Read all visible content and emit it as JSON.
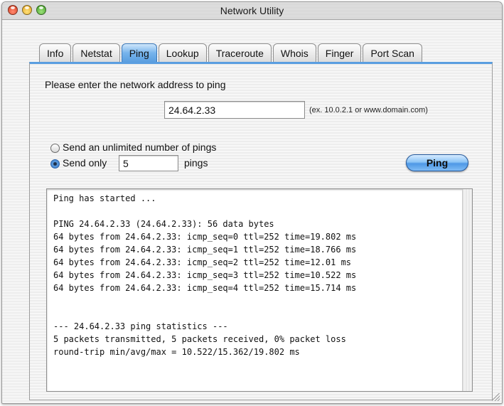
{
  "window": {
    "title": "Network Utility"
  },
  "tabs": [
    {
      "label": "Info",
      "active": false
    },
    {
      "label": "Netstat",
      "active": false
    },
    {
      "label": "Ping",
      "active": true
    },
    {
      "label": "Lookup",
      "active": false
    },
    {
      "label": "Traceroute",
      "active": false
    },
    {
      "label": "Whois",
      "active": false
    },
    {
      "label": "Finger",
      "active": false
    },
    {
      "label": "Port Scan",
      "active": false
    }
  ],
  "ping": {
    "prompt": "Please enter the network address to ping",
    "address": "24.64.2.33",
    "address_hint": "(ex. 10.0.2.1 or www.domain.com)",
    "option_unlimited": "Send an unlimited number of pings",
    "option_count_prefix": "Send only",
    "count": "5",
    "option_count_suffix": "pings",
    "selected_option": "count",
    "button_label": "Ping"
  },
  "output": {
    "lines": [
      "Ping has started ...",
      "",
      "PING 24.64.2.33 (24.64.2.33): 56 data bytes",
      "64 bytes from 24.64.2.33: icmp_seq=0 ttl=252 time=19.802 ms",
      "64 bytes from 24.64.2.33: icmp_seq=1 ttl=252 time=18.766 ms",
      "64 bytes from 24.64.2.33: icmp_seq=2 ttl=252 time=12.01 ms",
      "64 bytes from 24.64.2.33: icmp_seq=3 ttl=252 time=10.522 ms",
      "64 bytes from 24.64.2.33: icmp_seq=4 ttl=252 time=15.714 ms",
      "",
      "",
      "--- 24.64.2.33 ping statistics ---",
      "5 packets transmitted, 5 packets received, 0% packet loss",
      "round-trip min/avg/max = 10.522/15.362/19.802 ms"
    ]
  },
  "colors": {
    "accent": "#5a9ee0",
    "close": "#d63a1c",
    "minimize": "#e0a11a",
    "zoom": "#3f9e23"
  },
  "icons": {
    "close": "close-button-icon",
    "minimize": "minimize-button-icon",
    "zoom": "zoom-button-icon"
  }
}
